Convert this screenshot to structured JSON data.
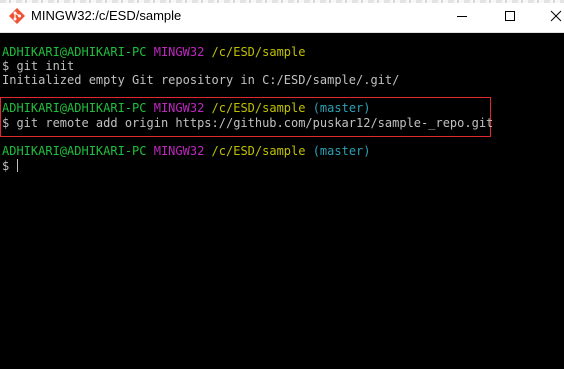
{
  "window": {
    "title": "MINGW32:/c/ESD/sample"
  },
  "terminal": {
    "block1": {
      "user": "ADHIKARI@ADHIKARI-PC",
      "shell": "MINGW32",
      "path": "/c/ESD/sample",
      "command": "$ git init",
      "output": "Initialized empty Git repository in C:/ESD/sample/.git/"
    },
    "block2": {
      "user": "ADHIKARI@ADHIKARI-PC",
      "shell": "MINGW32",
      "path": "/c/ESD/sample",
      "branch": "(master)",
      "command": "$ git remote add origin https://github.com/puskar12/sample-_repo.git"
    },
    "block3": {
      "user": "ADHIKARI@ADHIKARI-PC",
      "shell": "MINGW32",
      "path": "/c/ESD/sample",
      "branch": "(master)",
      "prompt": "$ "
    }
  },
  "colors": {
    "user": "#1fbf3d",
    "shell": "#bf27bf",
    "path": "#c0c000",
    "branch": "#2aa1b3",
    "text": "#c0c0c0",
    "highlight_border": "#e0282e",
    "background": "#000000"
  },
  "icons": {
    "app": "git-bash-icon",
    "minimize": "minimize-icon",
    "maximize": "maximize-icon",
    "close": "close-icon"
  }
}
